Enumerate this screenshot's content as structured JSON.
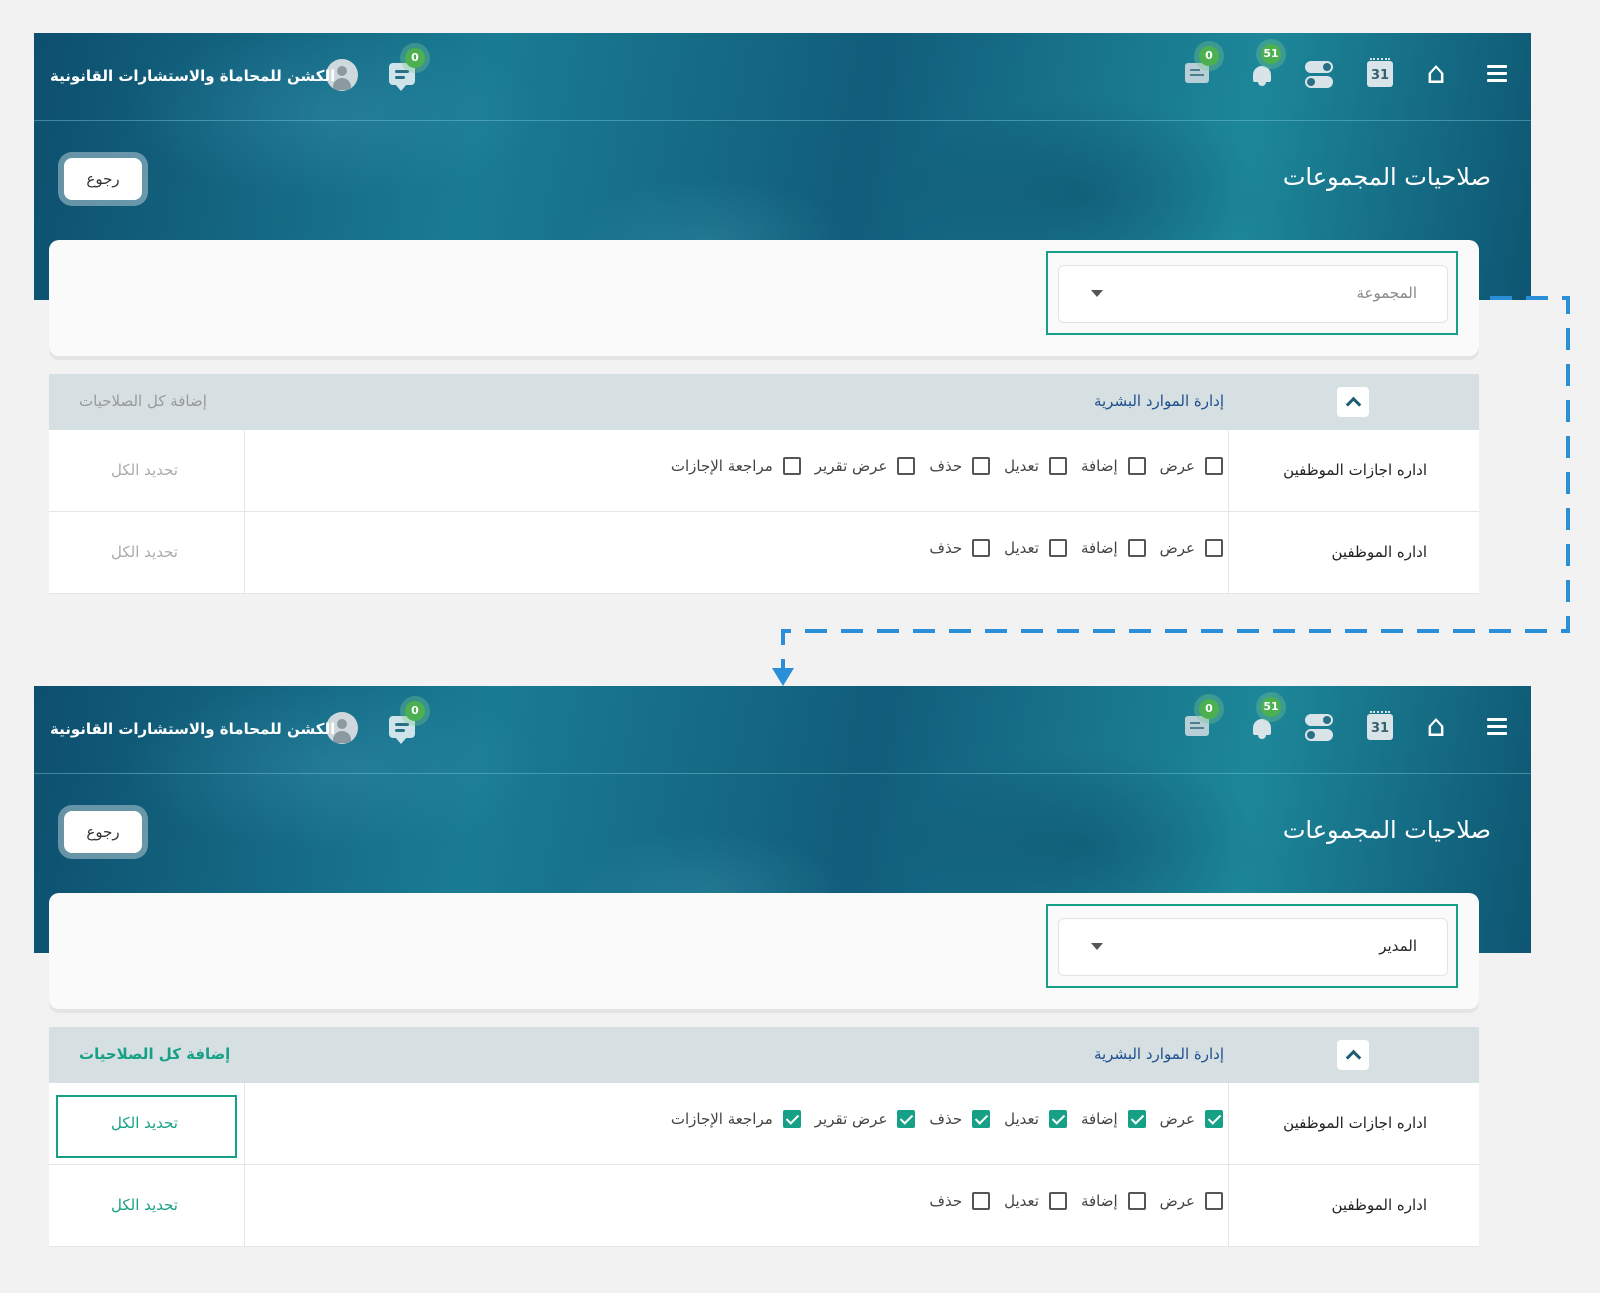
{
  "header": {
    "brand_name": "الكشن للمحاماة والاستشارات القانونية",
    "badges": {
      "chat": "0",
      "notifications": "51",
      "messages": "0"
    },
    "icons": [
      "menu-icon",
      "home-icon",
      "calendar-icon",
      "toggle-icon",
      "bell-icon",
      "message-icon",
      "chat-icon",
      "avatar"
    ],
    "calendar_day": "31"
  },
  "page": {
    "title": "صلاحيات المجموعات",
    "back_label": "رجوع"
  },
  "before": {
    "group_select": {
      "value": "المجموعة"
    },
    "section": {
      "title": "إدارة الموارد البشرية",
      "add_all": "إضافة كل الصلاحيات"
    },
    "rows": [
      {
        "name": "اداره اجازات الموظفين",
        "select_all": "تحديد الكل",
        "perms": [
          {
            "label": "عرض",
            "checked": false
          },
          {
            "label": "إضافة",
            "checked": false
          },
          {
            "label": "تعديل",
            "checked": false
          },
          {
            "label": "حذف",
            "checked": false
          },
          {
            "label": "عرض تقرير",
            "checked": false
          },
          {
            "label": "مراجعة الإجازات",
            "checked": false
          }
        ]
      },
      {
        "name": "اداره الموظفين",
        "select_all": "تحديد الكل",
        "perms": [
          {
            "label": "عرض",
            "checked": false
          },
          {
            "label": "إضافة",
            "checked": false
          },
          {
            "label": "تعديل",
            "checked": false
          },
          {
            "label": "حذف",
            "checked": false
          }
        ]
      }
    ]
  },
  "after": {
    "group_select": {
      "value": "المدير"
    },
    "section": {
      "title": "إدارة الموارد البشرية",
      "add_all": "إضافة كل الصلاحيات"
    },
    "rows": [
      {
        "name": "اداره اجازات الموظفين",
        "select_all": "تحديد الكل",
        "perms": [
          {
            "label": "عرض",
            "checked": true
          },
          {
            "label": "إضافة",
            "checked": true
          },
          {
            "label": "تعديل",
            "checked": true
          },
          {
            "label": "حذف",
            "checked": true
          },
          {
            "label": "عرض تقرير",
            "checked": true
          },
          {
            "label": "مراجعة الإجازات",
            "checked": true
          }
        ]
      },
      {
        "name": "اداره الموظفين",
        "select_all": "تحديد الكل",
        "perms": [
          {
            "label": "عرض",
            "checked": false
          },
          {
            "label": "إضافة",
            "checked": false
          },
          {
            "label": "تعديل",
            "checked": false
          },
          {
            "label": "حذف",
            "checked": false
          }
        ]
      }
    ]
  },
  "colors": {
    "accent": "#16a085",
    "arrow": "#2a8fd8",
    "section_title": "#1e4e8c"
  }
}
